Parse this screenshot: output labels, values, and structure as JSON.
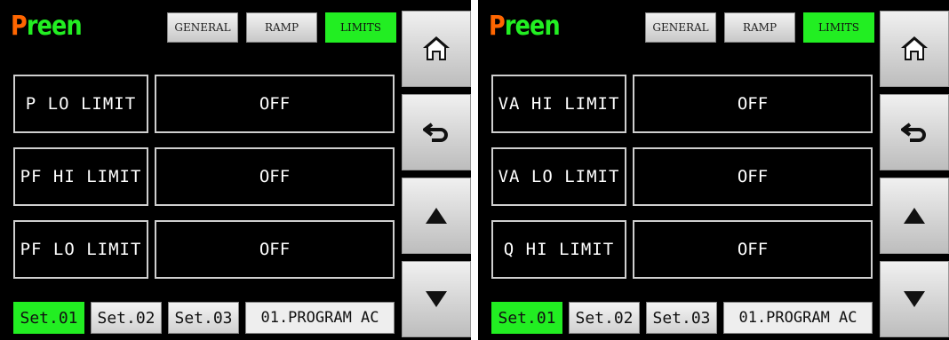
{
  "logo": {
    "first": "P",
    "rest": "reen"
  },
  "colors": {
    "accent_green": "#22ee22",
    "logo_orange": "#ff6600",
    "background": "#000000"
  },
  "tabs": [
    {
      "label": "GENERAL",
      "active": false
    },
    {
      "label": "RAMP",
      "active": false
    },
    {
      "label": "LIMITS",
      "active": true
    }
  ],
  "side_buttons": [
    "home-icon",
    "back-arrow-icon",
    "up-arrow-icon",
    "down-arrow-icon"
  ],
  "panels": [
    {
      "rows": [
        {
          "label": "P LO LIMIT",
          "value": "OFF"
        },
        {
          "label": "PF HI LIMIT",
          "value": "OFF"
        },
        {
          "label": "PF LO LIMIT",
          "value": "OFF"
        }
      ]
    },
    {
      "rows": [
        {
          "label": "VA HI LIMIT",
          "value": "OFF"
        },
        {
          "label": "VA LO LIMIT",
          "value": "OFF"
        },
        {
          "label": "Q HI LIMIT",
          "value": "OFF"
        }
      ]
    }
  ],
  "sets": [
    {
      "label": "Set.01",
      "active": true
    },
    {
      "label": "Set.02",
      "active": false
    },
    {
      "label": "Set.03",
      "active": false
    }
  ],
  "program": "01.PROGRAM AC"
}
